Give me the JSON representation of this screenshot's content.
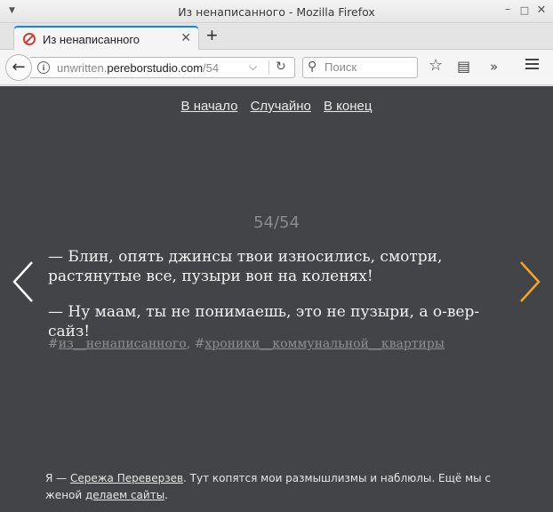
{
  "window": {
    "title": "Из ненаписанного - Mozilla Firefox"
  },
  "tabs": [
    {
      "label": "Из ненаписанного"
    }
  ],
  "navbar": {
    "url_prefix": "unwritten.",
    "url_host": "pereborstudio.com",
    "url_path": "/54",
    "search_placeholder": "Поиск"
  },
  "page": {
    "nav": {
      "start": "В начало",
      "random": "Случайно",
      "end": "В конец"
    },
    "counter": "54/54",
    "quote": [
      "— Блин, опять джинсы твои износились, смотри, растянутые все, пузыри вон на коленях!",
      "— Ну маам, ты не понимаешь, это не пузыри, а о-вер-сайз!"
    ],
    "tags": [
      {
        "hash": "#",
        "label": "из__ненаписанного"
      },
      {
        "hash": "#",
        "label": "хроники__коммунальной__квартиры"
      }
    ],
    "tag_separator": ", ",
    "footer": {
      "prefix": "Я — ",
      "author_link": "Сережа Переверзев",
      "middle": ". Тут копятся мои размышлизмы и наблюлы. Ещё мы с женой ",
      "studio_link": "делаем сайты",
      "suffix": "."
    },
    "colors": {
      "background": "#434447",
      "next_arrow": "#f5a623",
      "prev_arrow": "#ffffff"
    }
  }
}
